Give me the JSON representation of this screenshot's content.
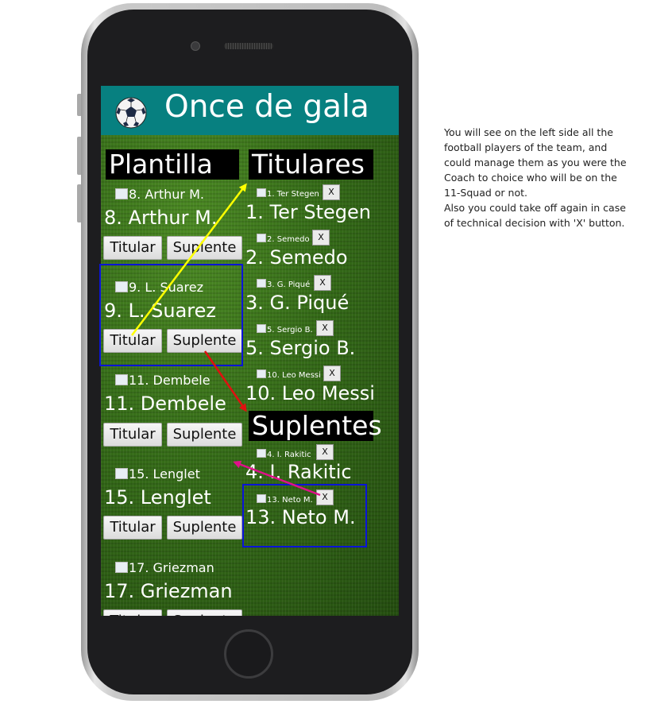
{
  "app": {
    "title": "Once de gala",
    "ball_icon": "soccer-ball-icon"
  },
  "sections": {
    "roster": "Plantilla",
    "starters": "Titulares",
    "subs": "Suplentes"
  },
  "buttons": {
    "starter": "Titular",
    "sub": "Suplente",
    "remove": "X"
  },
  "roster": [
    {
      "img_alt": "8. Arthur M.",
      "name": "8. Arthur M."
    },
    {
      "img_alt": "9. L. Suarez",
      "name": "9. L. Suarez"
    },
    {
      "img_alt": "11. Dembele",
      "name": "11. Dembele"
    },
    {
      "img_alt": "15. Lenglet",
      "name": "15. Lenglet"
    },
    {
      "img_alt": "17. Griezman",
      "name": "17. Griezman"
    }
  ],
  "starters": [
    {
      "img_alt": "1. Ter Stegen",
      "name": "1. Ter Stegen"
    },
    {
      "img_alt": "2. Semedo",
      "name": "2. Semedo"
    },
    {
      "img_alt": "3. G. Piqué",
      "name": "3. G. Piqué"
    },
    {
      "img_alt": "5. Sergio B.",
      "name": "5. Sergio B."
    },
    {
      "img_alt": "10. Leo Messi",
      "name": "10. Leo Messi"
    }
  ],
  "subs": [
    {
      "img_alt": "4. I. Rakitic",
      "name": "4. I. Rakitic"
    },
    {
      "img_alt": "13. Neto M.",
      "name": "13. Neto M."
    }
  ],
  "description": {
    "paragraph1": "You will see on the left side all the football players of the team, and could manage them as you were the Coach to choice who will be on the 11-Squad or not.",
    "paragraph2": "Also you could take off again in case of technical decision with 'X' button."
  },
  "colors": {
    "header": "#078080",
    "highlight_box": "#0a14d8",
    "arrow_yellow": "#ffff00",
    "arrow_red": "#e01010",
    "arrow_pink": "#e0108a"
  }
}
